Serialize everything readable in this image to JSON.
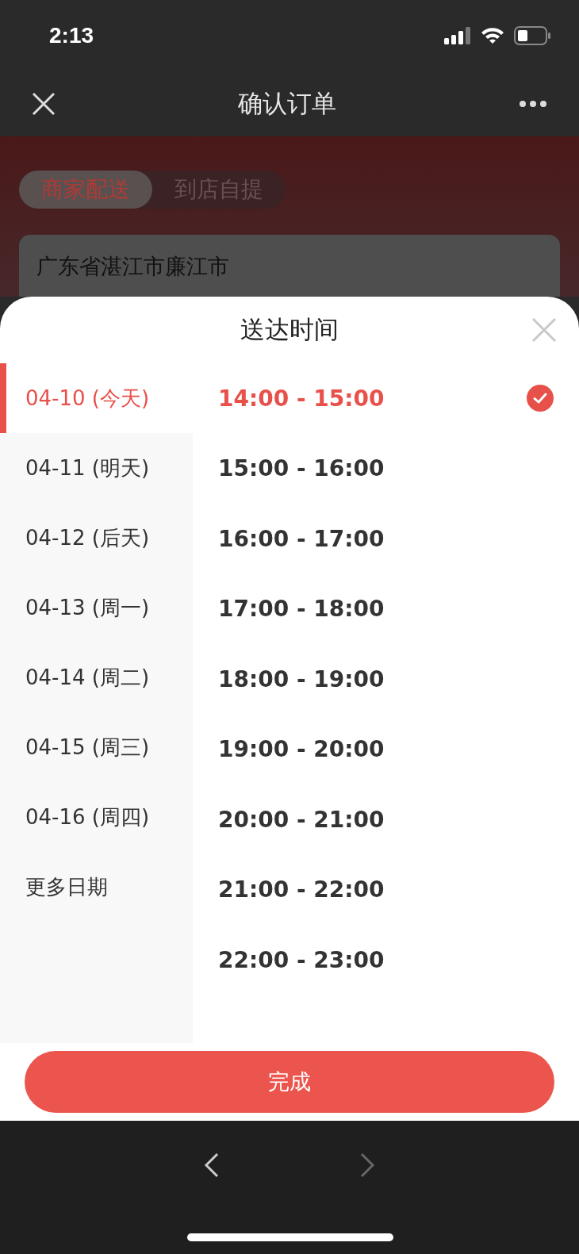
{
  "status_bar": {
    "time": "2:13"
  },
  "nav_bar": {
    "title": "确认订单"
  },
  "delivery_tabs": [
    {
      "label": "商家配送",
      "selected": true
    },
    {
      "label": "到店自提",
      "selected": false
    }
  ],
  "address": {
    "text": "广东省湛江市廉江市"
  },
  "sheet": {
    "title": "送达时间",
    "dates": [
      {
        "label": "04-10 (今天)",
        "selected": true
      },
      {
        "label": "04-11 (明天)",
        "selected": false
      },
      {
        "label": "04-12 (后天)",
        "selected": false
      },
      {
        "label": "04-13 (周一)",
        "selected": false
      },
      {
        "label": "04-14 (周二)",
        "selected": false
      },
      {
        "label": "04-15 (周三)",
        "selected": false
      },
      {
        "label": "04-16 (周四)",
        "selected": false
      },
      {
        "label": "更多日期",
        "selected": false
      }
    ],
    "time_slots": [
      {
        "label": "14:00 - 15:00",
        "selected": true
      },
      {
        "label": "15:00 - 16:00",
        "selected": false
      },
      {
        "label": "16:00 - 17:00",
        "selected": false
      },
      {
        "label": "17:00 - 18:00",
        "selected": false
      },
      {
        "label": "18:00 - 19:00",
        "selected": false
      },
      {
        "label": "19:00 - 20:00",
        "selected": false
      },
      {
        "label": "20:00 - 21:00",
        "selected": false
      },
      {
        "label": "21:00 - 22:00",
        "selected": false
      },
      {
        "label": "22:00 - 23:00",
        "selected": false
      }
    ],
    "done_button": "完成"
  },
  "browser_toolbar": {
    "back": {
      "disabled": false
    },
    "forward": {
      "disabled": true
    }
  }
}
